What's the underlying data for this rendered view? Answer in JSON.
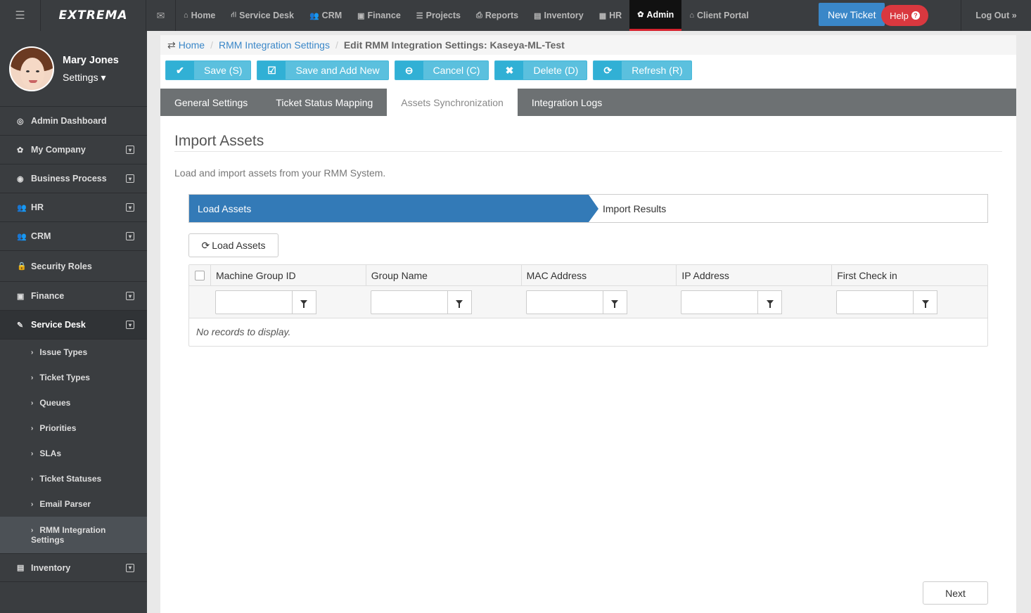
{
  "topnav": {
    "logo": "EXTREMA",
    "items": [
      {
        "label": "Home",
        "icon": "home-icon"
      },
      {
        "label": "Service Desk",
        "icon": "sitemap-icon"
      },
      {
        "label": "CRM",
        "icon": "users-icon"
      },
      {
        "label": "Finance",
        "icon": "money-icon"
      },
      {
        "label": "Projects",
        "icon": "list-icon"
      },
      {
        "label": "Reports",
        "icon": "reports-icon"
      },
      {
        "label": "Inventory",
        "icon": "inventory-icon"
      },
      {
        "label": "HR",
        "icon": "briefcase-icon"
      },
      {
        "label": "Admin",
        "icon": "gear-icon"
      },
      {
        "label": "Client Portal",
        "icon": "home-icon"
      }
    ],
    "new_ticket": "New Ticket",
    "help": "Help",
    "logout": "Log Out »"
  },
  "profile": {
    "name": "Mary Jones",
    "settings": "Settings ▾"
  },
  "sidebar": {
    "items": [
      {
        "label": "Admin Dashboard"
      },
      {
        "label": "My Company"
      },
      {
        "label": "Business Process"
      },
      {
        "label": "HR"
      },
      {
        "label": "CRM"
      },
      {
        "label": "Security Roles"
      },
      {
        "label": "Finance"
      },
      {
        "label": "Service Desk"
      },
      {
        "label": "Inventory"
      }
    ],
    "sub_items": [
      {
        "label": "Issue Types"
      },
      {
        "label": "Ticket Types"
      },
      {
        "label": "Queues"
      },
      {
        "label": "Priorities"
      },
      {
        "label": "SLAs"
      },
      {
        "label": "Ticket Statuses"
      },
      {
        "label": "Email Parser"
      },
      {
        "label_line1": "RMM Integration",
        "label_line2": "Settings"
      }
    ]
  },
  "breadcrumb": {
    "home": "Home",
    "parent": "RMM Integration Settings",
    "current": "Edit RMM Integration Settings: Kaseya-ML-Test"
  },
  "toolbar": {
    "save": "Save (S)",
    "save_add": "Save and Add New",
    "cancel": "Cancel (C)",
    "delete": "Delete (D)",
    "refresh": "Refresh (R)"
  },
  "tabs": [
    {
      "label": "General Settings"
    },
    {
      "label": "Ticket Status Mapping"
    },
    {
      "label": "Assets Synchronization"
    },
    {
      "label": "Integration Logs"
    }
  ],
  "section": {
    "title": "Import Assets",
    "description": "Load and import assets from your RMM System."
  },
  "wizard": {
    "step1": "Load Assets",
    "step2": "Import Results"
  },
  "load_button": "Load Assets",
  "grid": {
    "columns": [
      "Machine Group ID",
      "Group Name",
      "MAC Address",
      "IP Address",
      "First Check in"
    ],
    "empty": "No records to display."
  },
  "next_button": "Next",
  "colors": {
    "nav_bg": "#3a3d40",
    "primary": "#337ab7",
    "info": "#5bc0de",
    "danger": "#d9383f"
  }
}
